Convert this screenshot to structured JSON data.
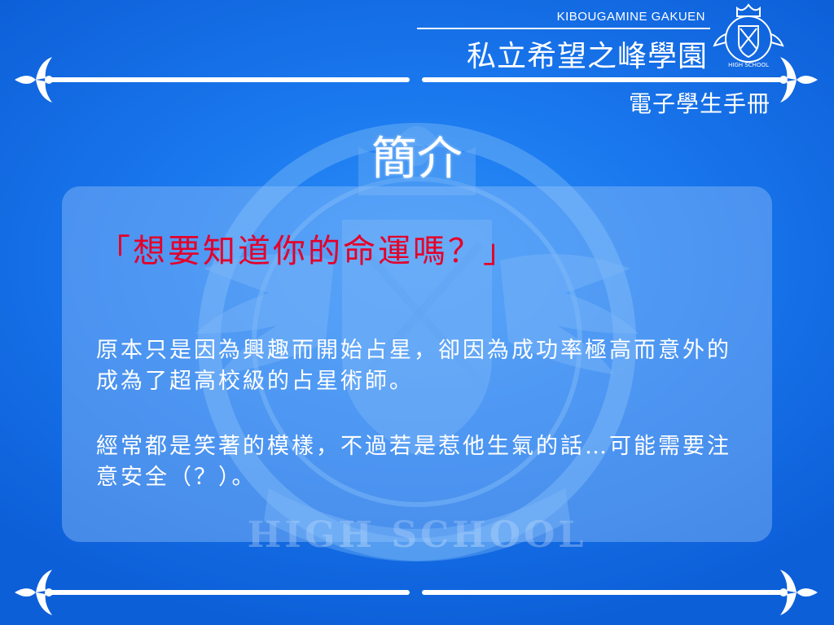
{
  "header": {
    "school_en": "KIBOUGAMINE GAKUEN",
    "school_zh": "私立希望之峰學園",
    "handbook": "電子學生手冊",
    "crest_banner": "HIGH SCHOOL"
  },
  "page": {
    "title": "簡介"
  },
  "profile": {
    "quote": "「想要知道你的命運嗎？」",
    "paragraphs": [
      "原本只是因為興趣而開始占星，卻因為成功率極高而意外的成為了超高校級的占星術師。",
      "經常都是笑著的模樣，不過若是惹他生氣的話…可能需要注意安全（？）。"
    ]
  },
  "watermark": {
    "text": "HIGH SCHOOL"
  },
  "colors": {
    "background": "#1a78ee",
    "quote": "#e4002a",
    "text": "#ffffff"
  }
}
